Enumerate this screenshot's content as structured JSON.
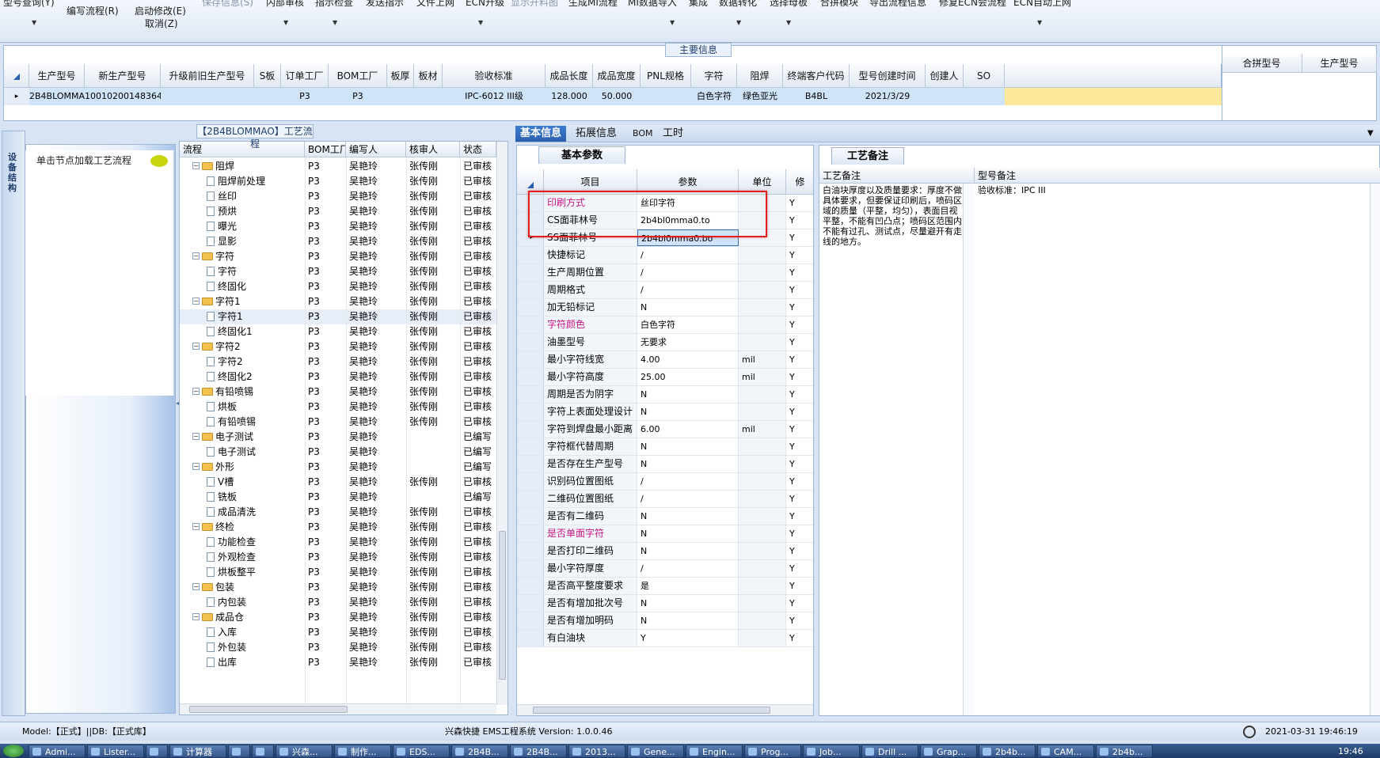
{
  "ribbon": {
    "buttons": [
      {
        "label": "型号查询(Y)"
      },
      {
        "label": "编写流程(R)"
      },
      {
        "label": "启动修改(E)"
      },
      {
        "label": "取消(Z)"
      },
      {
        "label": "保存信息(S)"
      },
      {
        "label": "内部审核"
      },
      {
        "label": "指示检查"
      },
      {
        "label": "发送指示"
      },
      {
        "label": "文件上网"
      },
      {
        "label": "ECN升级"
      },
      {
        "label": "显示开料图"
      },
      {
        "label": "生成MI流程"
      },
      {
        "label": "MI数据导入"
      },
      {
        "label": "集成"
      },
      {
        "label": "数据转化"
      },
      {
        "label": "选择母板"
      },
      {
        "label": "合拼模块"
      },
      {
        "label": "导出流程信息"
      },
      {
        "label": "修复ECN会流程"
      },
      {
        "label": "ECN自动上网"
      }
    ]
  },
  "main_info": {
    "title": "主要信息",
    "columns": [
      "生产型号",
      "新生产型号",
      "升级前旧生产型号",
      "S板",
      "订单工厂",
      "BOM工厂",
      "板厚",
      "板材",
      "验收标准",
      "成品长度",
      "成品宽度",
      "PNL规格",
      "字符",
      "阻焊",
      "终端客户代码",
      "型号创建时间",
      "创建人",
      "SO"
    ],
    "row": [
      "2B4BLOMMAO",
      "10010200148364",
      "",
      "",
      "P3",
      "P3",
      "",
      "",
      "IPC-6012 III级",
      "128.000",
      "50.000",
      "",
      "白色字符",
      "绿色亚光",
      "B4BL",
      "2021/3/29",
      "",
      ""
    ],
    "right_columns": [
      "合拼型号",
      "生产型号"
    ]
  },
  "left_panel": {
    "vertical_tab": "设备结构",
    "hint": "单击节点加载工艺流程"
  },
  "flow_tree": {
    "title": "【2B4BLOMMAO】工艺流程",
    "columns": [
      "流程",
      "BOM工厂",
      "编写人",
      "核审人",
      "状态"
    ],
    "rows": [
      {
        "level": 0,
        "name": "阻焊",
        "bom": "P3",
        "writer": "吴艳玲",
        "checker": "张传刚",
        "status": "已审核"
      },
      {
        "level": 1,
        "name": "阻焊前处理",
        "bom": "P3",
        "writer": "吴艳玲",
        "checker": "张传刚",
        "status": "已审核"
      },
      {
        "level": 1,
        "name": "丝印",
        "bom": "P3",
        "writer": "吴艳玲",
        "checker": "张传刚",
        "status": "已审核"
      },
      {
        "level": 1,
        "name": "预烘",
        "bom": "P3",
        "writer": "吴艳玲",
        "checker": "张传刚",
        "status": "已审核"
      },
      {
        "level": 1,
        "name": "曝光",
        "bom": "P3",
        "writer": "吴艳玲",
        "checker": "张传刚",
        "status": "已审核"
      },
      {
        "level": 1,
        "name": "显影",
        "bom": "P3",
        "writer": "吴艳玲",
        "checker": "张传刚",
        "status": "已审核"
      },
      {
        "level": 0,
        "name": "字符",
        "bom": "P3",
        "writer": "吴艳玲",
        "checker": "张传刚",
        "status": "已审核"
      },
      {
        "level": 1,
        "name": "字符",
        "bom": "P3",
        "writer": "吴艳玲",
        "checker": "张传刚",
        "status": "已审核"
      },
      {
        "level": 1,
        "name": "终固化",
        "bom": "P3",
        "writer": "吴艳玲",
        "checker": "张传刚",
        "status": "已审核"
      },
      {
        "level": 0,
        "name": "字符1",
        "bom": "P3",
        "writer": "吴艳玲",
        "checker": "张传刚",
        "status": "已审核"
      },
      {
        "level": 1,
        "name": "字符1",
        "bom": "P3",
        "writer": "吴艳玲",
        "checker": "张传刚",
        "status": "已审核"
      },
      {
        "level": 1,
        "name": "终固化1",
        "bom": "P3",
        "writer": "吴艳玲",
        "checker": "张传刚",
        "status": "已审核"
      },
      {
        "level": 0,
        "name": "字符2",
        "bom": "P3",
        "writer": "吴艳玲",
        "checker": "张传刚",
        "status": "已审核"
      },
      {
        "level": 1,
        "name": "字符2",
        "bom": "P3",
        "writer": "吴艳玲",
        "checker": "张传刚",
        "status": "已审核"
      },
      {
        "level": 1,
        "name": "终固化2",
        "bom": "P3",
        "writer": "吴艳玲",
        "checker": "张传刚",
        "status": "已审核"
      },
      {
        "level": 0,
        "name": "有铅喷锡",
        "bom": "P3",
        "writer": "吴艳玲",
        "checker": "张传刚",
        "status": "已审核"
      },
      {
        "level": 1,
        "name": "烘板",
        "bom": "P3",
        "writer": "吴艳玲",
        "checker": "张传刚",
        "status": "已审核"
      },
      {
        "level": 1,
        "name": "有铅喷锡",
        "bom": "P3",
        "writer": "吴艳玲",
        "checker": "张传刚",
        "status": "已审核"
      },
      {
        "level": 0,
        "name": "电子测试",
        "bom": "P3",
        "writer": "吴艳玲",
        "checker": "",
        "status": "已编写"
      },
      {
        "level": 1,
        "name": "电子测试",
        "bom": "P3",
        "writer": "吴艳玲",
        "checker": "",
        "status": "已编写"
      },
      {
        "level": 0,
        "name": "外形",
        "bom": "P3",
        "writer": "吴艳玲",
        "checker": "",
        "status": "已编写"
      },
      {
        "level": 1,
        "name": "V槽",
        "bom": "P3",
        "writer": "吴艳玲",
        "checker": "张传刚",
        "status": "已审核"
      },
      {
        "level": 1,
        "name": "铣板",
        "bom": "P3",
        "writer": "吴艳玲",
        "checker": "",
        "status": "已编写"
      },
      {
        "level": 1,
        "name": "成品清洗",
        "bom": "P3",
        "writer": "吴艳玲",
        "checker": "张传刚",
        "status": "已审核"
      },
      {
        "level": 0,
        "name": "终检",
        "bom": "P3",
        "writer": "吴艳玲",
        "checker": "张传刚",
        "status": "已审核"
      },
      {
        "level": 1,
        "name": "功能检查",
        "bom": "P3",
        "writer": "吴艳玲",
        "checker": "张传刚",
        "status": "已审核"
      },
      {
        "level": 1,
        "name": "外观检查",
        "bom": "P3",
        "writer": "吴艳玲",
        "checker": "张传刚",
        "status": "已审核"
      },
      {
        "level": 1,
        "name": "烘板整平",
        "bom": "P3",
        "writer": "吴艳玲",
        "checker": "张传刚",
        "status": "已审核"
      },
      {
        "level": 0,
        "name": "包装",
        "bom": "P3",
        "writer": "吴艳玲",
        "checker": "张传刚",
        "status": "已审核"
      },
      {
        "level": 1,
        "name": "内包装",
        "bom": "P3",
        "writer": "吴艳玲",
        "checker": "张传刚",
        "status": "已审核"
      },
      {
        "level": 0,
        "name": "成品仓",
        "bom": "P3",
        "writer": "吴艳玲",
        "checker": "张传刚",
        "status": "已审核"
      },
      {
        "level": 1,
        "name": "入库",
        "bom": "P3",
        "writer": "吴艳玲",
        "checker": "张传刚",
        "status": "已审核"
      },
      {
        "level": 1,
        "name": "外包装",
        "bom": "P3",
        "writer": "吴艳玲",
        "checker": "张传刚",
        "status": "已审核"
      },
      {
        "level": 1,
        "name": "出库",
        "bom": "P3",
        "writer": "吴艳玲",
        "checker": "张传刚",
        "status": "已审核"
      }
    ]
  },
  "tabs": [
    "基本信息",
    "拓展信息",
    "BOM",
    "工时"
  ],
  "params": {
    "subtab": "基本参数",
    "columns": [
      "项目",
      "参数",
      "单位",
      "修"
    ],
    "rows": [
      {
        "item": "印刷方式",
        "value": "丝印字符",
        "unit": "",
        "flag": "Y",
        "highlight": true
      },
      {
        "item": "CS面菲林号",
        "value": "2b4bl0mma0.to",
        "unit": "",
        "flag": "Y",
        "highlight": false
      },
      {
        "item": "SS面菲林号",
        "value": "2b4bl0mma0.bo",
        "unit": "",
        "flag": "Y",
        "highlight": false
      },
      {
        "item": "快捷标记",
        "value": "/",
        "unit": "",
        "flag": "Y",
        "highlight": false
      },
      {
        "item": "生产周期位置",
        "value": "/",
        "unit": "",
        "flag": "Y",
        "highlight": false
      },
      {
        "item": "周期格式",
        "value": "/",
        "unit": "",
        "flag": "Y",
        "highlight": false
      },
      {
        "item": "加无铅标记",
        "value": "N",
        "unit": "",
        "flag": "Y",
        "highlight": false
      },
      {
        "item": "字符颜色",
        "value": "白色字符",
        "unit": "",
        "flag": "Y",
        "highlight": true
      },
      {
        "item": "油墨型号",
        "value": "无要求",
        "unit": "",
        "flag": "Y",
        "highlight": false
      },
      {
        "item": "最小字符线宽",
        "value": "4.00",
        "unit": "mil",
        "flag": "Y",
        "highlight": false
      },
      {
        "item": "最小字符高度",
        "value": "25.00",
        "unit": "mil",
        "flag": "Y",
        "highlight": false
      },
      {
        "item": "周期是否为阴字",
        "value": "N",
        "unit": "",
        "flag": "Y",
        "highlight": false
      },
      {
        "item": "字符上表面处理设计",
        "value": "N",
        "unit": "",
        "flag": "Y",
        "highlight": false
      },
      {
        "item": "字符到焊盘最小距离",
        "value": "6.00",
        "unit": "mil",
        "flag": "Y",
        "highlight": false
      },
      {
        "item": "字符框代替周期",
        "value": "N",
        "unit": "",
        "flag": "Y",
        "highlight": false
      },
      {
        "item": "是否存在生产型号",
        "value": "N",
        "unit": "",
        "flag": "Y",
        "highlight": false
      },
      {
        "item": "识别码位置图纸",
        "value": "/",
        "unit": "",
        "flag": "Y",
        "highlight": false
      },
      {
        "item": "二维码位置图纸",
        "value": "/",
        "unit": "",
        "flag": "Y",
        "highlight": false
      },
      {
        "item": "是否有二维码",
        "value": "N",
        "unit": "",
        "flag": "Y",
        "highlight": false
      },
      {
        "item": "是否单面字符",
        "value": "N",
        "unit": "",
        "flag": "Y",
        "highlight": true
      },
      {
        "item": "是否打印二维码",
        "value": "N",
        "unit": "",
        "flag": "Y",
        "highlight": false
      },
      {
        "item": "最小字符厚度",
        "value": "/",
        "unit": "",
        "flag": "Y",
        "highlight": false
      },
      {
        "item": "是否高平整度要求",
        "value": "是",
        "unit": "",
        "flag": "Y",
        "highlight": false
      },
      {
        "item": "是否有增加批次号",
        "value": "N",
        "unit": "",
        "flag": "Y",
        "highlight": false
      },
      {
        "item": "是否有增加明码",
        "value": "N",
        "unit": "",
        "flag": "Y",
        "highlight": false
      },
      {
        "item": "有白油块",
        "value": "Y",
        "unit": "",
        "flag": "Y",
        "highlight": false
      }
    ]
  },
  "notes": {
    "tab": "工艺备注",
    "col1": "工艺备注",
    "col2": "型号备注",
    "craft_text": "白油块厚度以及质量要求：厚度不做具体要求，但要保证印刷后，喷码区域的质量（平整，均匀），表面目视平整，不能有凹凸点；喷码区范围内不能有过孔、测试点，尽量避开有走线的地方。",
    "model_text": "验收标准：IPC III"
  },
  "status": {
    "left": "Model:【正式】||DB:【正式库】",
    "center": "兴森快捷 EMS工程系统 Version: 1.0.0.46",
    "datetime": "2021-03-31 19:46:19"
  },
  "taskbar": {
    "items": [
      "Admi...",
      "Lister...",
      "",
      "计算器",
      "",
      "",
      "兴森...",
      "制作...",
      "EDS...",
      "2B4B...",
      "2B4B...",
      "2013...",
      "Gene...",
      "Engin...",
      "Prog...",
      "Job...",
      "Drill ...",
      "Grap...",
      "2b4b...",
      "CAM...",
      "2b4b..."
    ],
    "clock": "19:46"
  },
  "colors": {
    "accent": "#2a5fae",
    "highlight_text": "#c71585",
    "selection_row": "#cfe3f9",
    "red_box": "#e02020"
  }
}
